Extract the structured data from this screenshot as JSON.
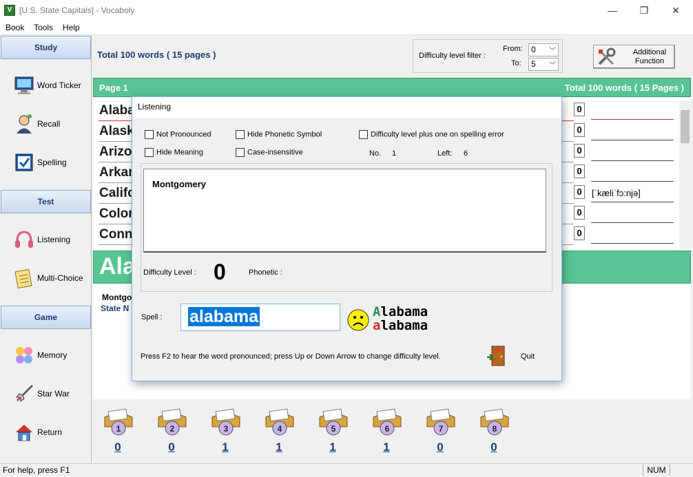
{
  "window": {
    "title": "[U.S. State Capitals] - Vocaboly",
    "app_icon": "V",
    "minimize": "—",
    "maximize": "❐",
    "close": "✕"
  },
  "menu": [
    "Book",
    "Tools",
    "Help"
  ],
  "sidebar": {
    "study_header": "Study",
    "test_header": "Test",
    "game_header": "Game",
    "items": [
      {
        "label": "Word Ticker",
        "icon": "monitor-icon"
      },
      {
        "label": "Recall",
        "icon": "person-thinking-icon"
      },
      {
        "label": "Spelling",
        "icon": "spelling-board-icon"
      },
      {
        "label": "Listening",
        "icon": "headphones-icon"
      },
      {
        "label": "Multi-Choice",
        "icon": "notepad-icon"
      },
      {
        "label": "Memory",
        "icon": "faces-icon"
      },
      {
        "label": "Star War",
        "icon": "rocket-icon"
      },
      {
        "label": "Return",
        "icon": "house-icon"
      }
    ]
  },
  "summary": {
    "total": "Total 100 words ( 15 pages )"
  },
  "filter": {
    "label": "Difficulty level filter :",
    "from_label": "From:",
    "from_value": "0",
    "to_label": "To:",
    "to_value": "5"
  },
  "additional": {
    "line1": "Additional",
    "line2": "Function"
  },
  "page_header": {
    "page": "Page 1",
    "total": "Total 100 words ( 15 Pages )"
  },
  "words": [
    {
      "text": "Alaba",
      "score": "0",
      "phonetic": ""
    },
    {
      "text": "Alask",
      "score": "0",
      "phonetic": ""
    },
    {
      "text": "Arizo",
      "score": "0",
      "phonetic": ""
    },
    {
      "text": "Arkar",
      "score": "0",
      "phonetic": ""
    },
    {
      "text": "Califo",
      "score": "0",
      "phonetic": "[ˈkæliˈfɔ:njə]"
    },
    {
      "text": "Color",
      "score": "0",
      "phonetic": ""
    },
    {
      "text": "Conn",
      "score": "0",
      "phonetic": ""
    }
  ],
  "big_word": "Ala",
  "detail": {
    "meaning": "Montgo",
    "label": "State N"
  },
  "folders": [
    {
      "num": "1",
      "count": "0"
    },
    {
      "num": "2",
      "count": "0"
    },
    {
      "num": "3",
      "count": "1"
    },
    {
      "num": "4",
      "count": "1"
    },
    {
      "num": "5",
      "count": "1"
    },
    {
      "num": "6",
      "count": "1"
    },
    {
      "num": "7",
      "count": "0"
    },
    {
      "num": "8",
      "count": "0"
    }
  ],
  "status": {
    "help": "For help, press F1",
    "num": "NUM"
  },
  "dialog": {
    "title": "Listening",
    "options": {
      "not_pronounced": "Not Pronounced",
      "hide_phonetic": "Hide Phonetic Symbol",
      "difficulty_plus": "Difficulty level plus one on spelling error",
      "hide_meaning": "Hide Meaning",
      "case_insensitive": "Case-insensitive"
    },
    "no_label": "No.",
    "no_value": "1",
    "left_label": "Left:",
    "left_value": "6",
    "meaning": "Montgomery",
    "difficulty_label": "Difficulty Level :",
    "difficulty_value": "0",
    "phonetic_label": "Phonetic :",
    "spell_label": "Spell :",
    "spell_value": "alabama",
    "answer_upper_first": "A",
    "answer_upper_rest": "labama",
    "answer_lower_first": "a",
    "answer_lower_rest": "labama",
    "hint": "Press F2 to hear the word pronounced; press Up or Down Arrow to change difficulty level.",
    "quit": "Quit"
  },
  "colors": {
    "accent_green": "#58c494",
    "link_blue": "#1a3c74",
    "selection": "#0078d7"
  }
}
